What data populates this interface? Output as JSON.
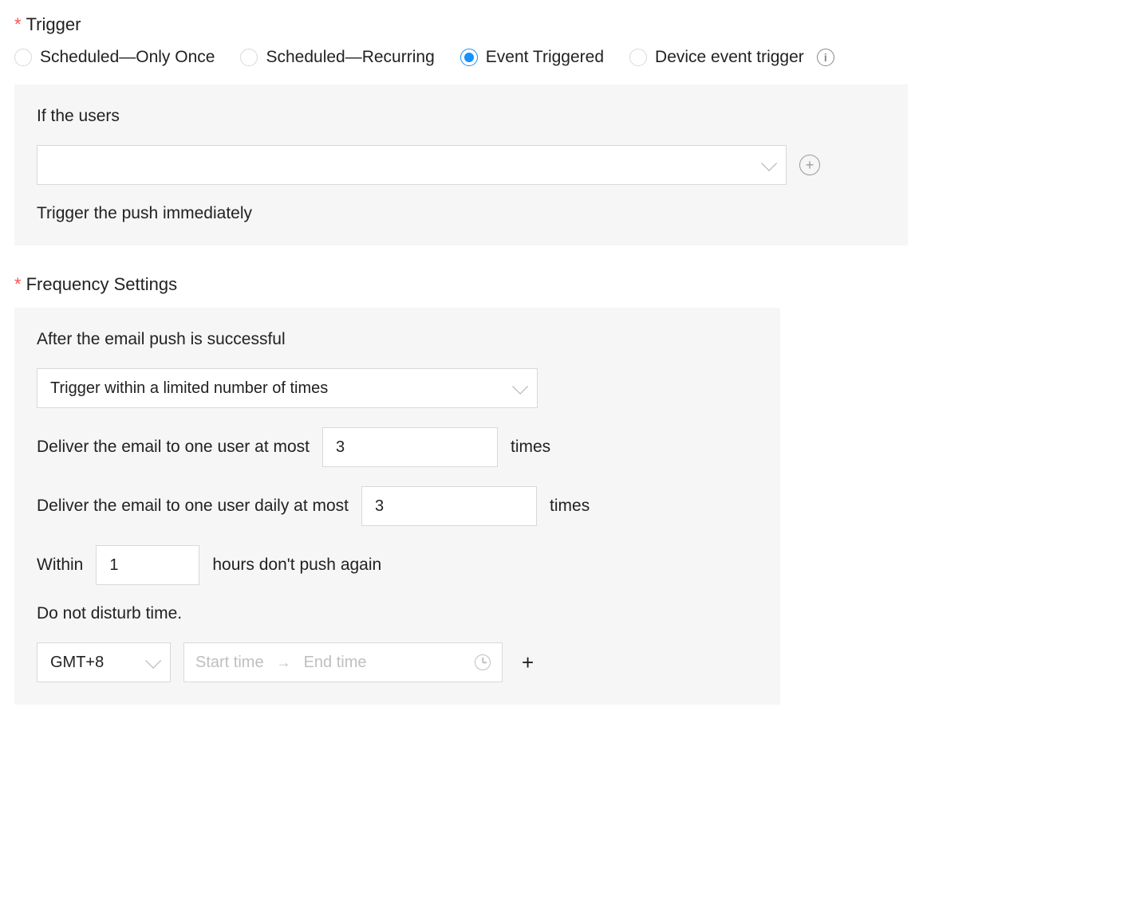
{
  "trigger": {
    "label": "Trigger",
    "options": {
      "once": "Scheduled—Only Once",
      "recurring": "Scheduled—Recurring",
      "event": "Event Triggered",
      "device": "Device event trigger"
    },
    "selected": "event",
    "panel": {
      "if_users_label": "If the users",
      "users_value": "",
      "push_immediate_label": "Trigger the push immediately"
    }
  },
  "frequency": {
    "label": "Frequency Settings",
    "after_success_label": "After the email push is successful",
    "mode_value": "Trigger within a limited number of times",
    "deliver_at_most_label": "Deliver the email to one user at most",
    "deliver_at_most_value": "3",
    "deliver_daily_label": "Deliver the email to one user daily at most",
    "deliver_daily_value": "3",
    "times_suffix": "times",
    "within_prefix": "Within",
    "within_value": "1",
    "within_suffix": "hours don't push again",
    "dnd_label": "Do not disturb time.",
    "timezone_value": "GMT+8",
    "start_placeholder": "Start time",
    "end_placeholder": "End time"
  }
}
